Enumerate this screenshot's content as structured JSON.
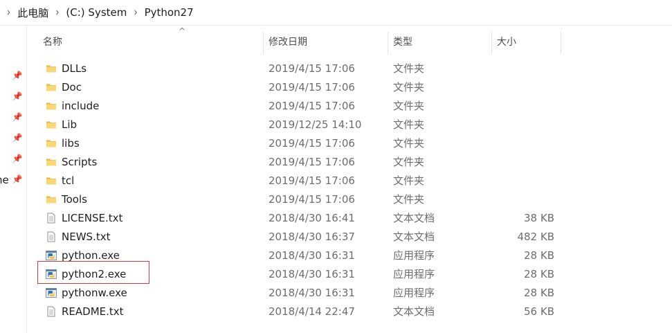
{
  "breadcrumb": [
    "此电脑",
    "(C:) System",
    "Python27"
  ],
  "navpane_partial_text": "ne",
  "columns": {
    "name": "名称",
    "date": "修改日期",
    "type": "类型",
    "size": "大小"
  },
  "files": [
    {
      "name": "DLLs",
      "date": "2019/4/15 17:06",
      "type": "文件夹",
      "size": "",
      "icon": "folder-icon"
    },
    {
      "name": "Doc",
      "date": "2019/4/15 17:06",
      "type": "文件夹",
      "size": "",
      "icon": "folder-icon"
    },
    {
      "name": "include",
      "date": "2019/4/15 17:06",
      "type": "文件夹",
      "size": "",
      "icon": "folder-icon"
    },
    {
      "name": "Lib",
      "date": "2019/12/25 14:10",
      "type": "文件夹",
      "size": "",
      "icon": "folder-icon"
    },
    {
      "name": "libs",
      "date": "2019/4/15 17:06",
      "type": "文件夹",
      "size": "",
      "icon": "folder-icon"
    },
    {
      "name": "Scripts",
      "date": "2019/4/15 17:06",
      "type": "文件夹",
      "size": "",
      "icon": "folder-icon"
    },
    {
      "name": "tcl",
      "date": "2019/4/15 17:06",
      "type": "文件夹",
      "size": "",
      "icon": "folder-icon"
    },
    {
      "name": "Tools",
      "date": "2019/4/15 17:06",
      "type": "文件夹",
      "size": "",
      "icon": "folder-icon"
    },
    {
      "name": "LICENSE.txt",
      "date": "2018/4/30 16:41",
      "type": "文本文档",
      "size": "38 KB",
      "icon": "text-file-icon"
    },
    {
      "name": "NEWS.txt",
      "date": "2018/4/30 16:37",
      "type": "文本文档",
      "size": "482 KB",
      "icon": "text-file-icon"
    },
    {
      "name": "python.exe",
      "date": "2018/4/30 16:31",
      "type": "应用程序",
      "size": "28 KB",
      "icon": "python-exe-icon"
    },
    {
      "name": "python2.exe",
      "date": "2018/4/30 16:31",
      "type": "应用程序",
      "size": "28 KB",
      "icon": "python-exe-icon"
    },
    {
      "name": "pythonw.exe",
      "date": "2018/4/30 16:31",
      "type": "应用程序",
      "size": "28 KB",
      "icon": "python-exe-icon"
    },
    {
      "name": "README.txt",
      "date": "2018/4/14 22:47",
      "type": "文本文档",
      "size": "56 KB",
      "icon": "text-file-icon"
    }
  ],
  "highlighted_file": "python2.exe",
  "colors": {
    "folder": "#f5c542",
    "highlight_border": "#d93a3a"
  }
}
